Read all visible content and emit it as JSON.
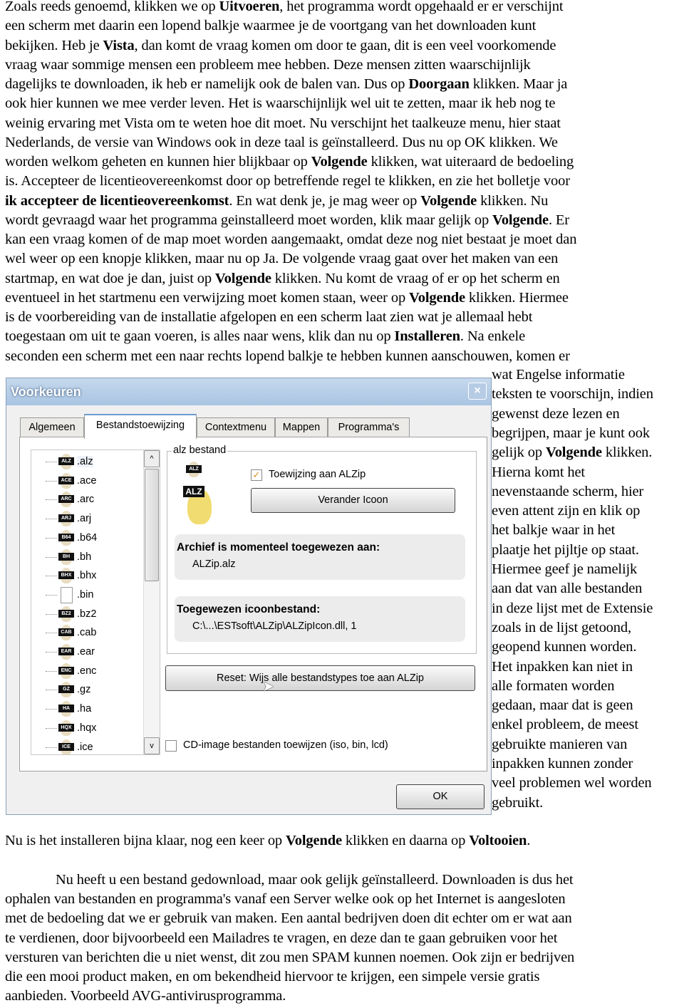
{
  "intro_lines": [
    [
      {
        "t": "Zoals reeds genoemd, klikken we op "
      },
      {
        "t": "Uitvoeren",
        "b": true
      },
      {
        "t": ", het programma wordt opgehaald er er verschijnt"
      }
    ],
    [
      {
        "t": "een scherm met daarin een lopend balkje waarmee je de voortgang van het downloaden kunt"
      }
    ],
    [
      {
        "t": "bekijken. Heb je "
      },
      {
        "t": "Vista",
        "b": true
      },
      {
        "t": ", dan komt de vraag komen om door te gaan, dit is een veel voorkomende"
      }
    ],
    [
      {
        "t": "vraag waar sommige mensen een probleem mee hebben. Deze mensen zitten waarschijnlijk"
      }
    ],
    [
      {
        "t": "dagelijks te downloaden, ik heb er namelijk ook de balen van. Dus op "
      },
      {
        "t": "Doorgaan",
        "b": true
      },
      {
        "t": " klikken. Maar ja"
      }
    ],
    [
      {
        "t": "ook hier kunnen we mee verder leven. Het is waarschijnlijk wel uit te zetten, maar ik heb nog te"
      }
    ],
    [
      {
        "t": "weinig ervaring met Vista om te weten hoe dit moet. Nu verschijnt het taalkeuze menu, hier staat"
      }
    ],
    [
      {
        "t": "Nederlands, de versie van Windows ook in deze taal is geïnstalleerd. Dus nu op OK klikken. We"
      }
    ],
    [
      {
        "t": "worden welkom geheten en kunnen hier blijkbaar op "
      },
      {
        "t": "Volgende",
        "b": true
      },
      {
        "t": " klikken, wat uiteraard de bedoeling"
      }
    ],
    [
      {
        "t": "is. Accepteer de licentieovereenkomst door op betreffende regel te klikken, en zie het bolletje voor"
      }
    ],
    [
      {
        "t": "ik accepteer de licentieovereenkomst",
        "b": true
      },
      {
        "t": ". En wat denk je, je mag weer op "
      },
      {
        "t": "Volgende",
        "b": true
      },
      {
        "t": " klikken. Nu"
      }
    ],
    [
      {
        "t": "wordt gevraagd waar het programma geinstalleerd moet worden, klik maar gelijk op "
      },
      {
        "t": "Volgende",
        "b": true
      },
      {
        "t": ". Er"
      }
    ],
    [
      {
        "t": "kan een vraag komen of de map moet worden aangemaakt, omdat deze nog niet bestaat je moet dan"
      }
    ],
    [
      {
        "t": "wel weer op een knopje klikken, maar nu op Ja. De volgende vraag gaat over het maken van een"
      }
    ],
    [
      {
        "t": "startmap, en wat doe je dan, juist op "
      },
      {
        "t": "Volgende",
        "b": true
      },
      {
        "t": " klikken. Nu komt de vraag of er op het scherm en"
      }
    ],
    [
      {
        "t": "eventueel in het startmenu een verwijzing moet komen staan, weer op "
      },
      {
        "t": "Volgende",
        "b": true
      },
      {
        "t": " klikken. Hiermee"
      }
    ],
    [
      {
        "t": "is de voorbereiding van de installatie afgelopen en een scherm laat zien wat je allemaal hebt"
      }
    ],
    [
      {
        "t": "toegestaan om uit te gaan voeren, is alles naar wens, klik dan nu op "
      },
      {
        "t": "Installeren",
        "b": true
      },
      {
        "t": ". Na enkele"
      }
    ],
    [
      {
        "t": "seconden een scherm met een naar rechts lopend balkje te hebben kunnen aanschouwen, komen er"
      }
    ]
  ],
  "side_lines": [
    [
      {
        "t": "wat Engelse informatie"
      }
    ],
    [
      {
        "t": "teksten te voorschijn, indien"
      }
    ],
    [
      {
        "t": "gewenst deze lezen en"
      }
    ],
    [
      {
        "t": "begrijpen, maar je kunt ook"
      }
    ],
    [
      {
        "t": "gelijk op "
      },
      {
        "t": "Volgende",
        "b": true
      },
      {
        "t": " klikken."
      }
    ],
    [
      {
        "t": "Hierna komt het"
      }
    ],
    [
      {
        "t": "nevenstaande scherm, hier"
      }
    ],
    [
      {
        "t": "even attent zijn en klik op"
      }
    ],
    [
      {
        "t": "het balkje waar in het"
      }
    ],
    [
      {
        "t": "plaatje het pijltje op staat."
      }
    ],
    [
      {
        "t": "Hiermee geef je namelijk"
      }
    ],
    [
      {
        "t": "aan dat van alle bestanden"
      }
    ],
    [
      {
        "t": "in deze lijst met de Extensie"
      }
    ],
    [
      {
        "t": "zoals in de lijst getoond,"
      }
    ],
    [
      {
        "t": "geopend kunnen worden."
      }
    ],
    [
      {
        "t": "Het inpakken kan niet in"
      }
    ],
    [
      {
        "t": "alle formaten worden"
      }
    ],
    [
      {
        "t": "gedaan, maar dat is geen"
      }
    ],
    [
      {
        "t": "enkel probleem, de meest"
      }
    ],
    [
      {
        "t": "gebruikte manieren van"
      }
    ],
    [
      {
        "t": "inpakken kunnen zonder"
      }
    ],
    [
      {
        "t": "veel problemen wel worden"
      }
    ],
    [
      {
        "t": "gebruikt."
      }
    ]
  ],
  "after_lines": [
    [
      {
        "t": "Nu is het installeren bijna klaar, nog een keer op "
      },
      {
        "t": "Volgende",
        "b": true
      },
      {
        "t": " klikken en daarna op "
      },
      {
        "t": "Voltooien",
        "b": true
      },
      {
        "t": "."
      }
    ]
  ],
  "final_lines": [
    [
      {
        "t": "Nu heeft u een bestand gedownload, maar ook gelijk geïnstalleerd. Downloaden is dus het"
      }
    ],
    [
      {
        "t": "ophalen van bestanden en programma's vanaf een Server welke ook op het Internet is aangesloten"
      }
    ],
    [
      {
        "t": "met de bedoeling dat we er gebruik van maken. Een aantal bedrijven doen dit echter om er wat aan"
      }
    ],
    [
      {
        "t": "te verdienen, door bijvoorbeeld een Mailadres te vragen, en deze dan te gaan gebruiken voor het"
      }
    ],
    [
      {
        "t": "versturen van berichten die u niet wenst, dit zou men SPAM kunnen noemen. Ook zijn er bedrijven"
      }
    ],
    [
      {
        "t": "die een mooi product maken, en om bekendheid hiervoor te krijgen, een simpele versie gratis"
      }
    ],
    [
      {
        "t": "aanbieden. Voorbeeld AVG-antivirusprogramma."
      }
    ]
  ],
  "dialog": {
    "title": "Voorkeuren",
    "close": "×",
    "tabs": [
      "Algemeen",
      "Bestandstoewijzing",
      "Contextmenu",
      "Mappen",
      "Programma's"
    ],
    "active_tab": "Bestandstoewijzing",
    "extensions": [
      {
        "ext": ".alz",
        "badge": "ALZ"
      },
      {
        "ext": ".ace",
        "badge": "ACE"
      },
      {
        "ext": ".arc",
        "badge": "ARC"
      },
      {
        "ext": ".arj",
        "badge": "ARJ"
      },
      {
        "ext": ".b64",
        "badge": "B64"
      },
      {
        "ext": ".bh",
        "badge": "BH"
      },
      {
        "ext": ".bhx",
        "badge": "BHX"
      },
      {
        "ext": ".bin",
        "badge": ""
      },
      {
        "ext": ".bz2",
        "badge": "BZ2"
      },
      {
        "ext": ".cab",
        "badge": "CAB"
      },
      {
        "ext": ".ear",
        "badge": "EAR"
      },
      {
        "ext": ".enc",
        "badge": "ENC"
      },
      {
        "ext": ".gz",
        "badge": "GZ"
      },
      {
        "ext": ".ha",
        "badge": "HA"
      },
      {
        "ext": ".hqx",
        "badge": "HQX"
      },
      {
        "ext": ".ice",
        "badge": "ICE"
      }
    ],
    "group_label": "alz bestand",
    "icon_small": "ALZ",
    "icon_large": "ALZ",
    "assign_checkbox": {
      "label": "Toewijzing aan ALZip",
      "checked": true
    },
    "change_icon_button": "Verander Icoon",
    "assigned_heading": "Archief is momenteel toegewezen aan:",
    "assigned_value": "ALZip.alz",
    "iconfile_heading": "Toegewezen icoonbestand:",
    "iconfile_value": "C:\\...\\ESTsoft\\ALZip\\ALZipIcon.dll, 1",
    "reset_button": "Reset: Wijs alle bestandstypes toe aan ALZip",
    "cd_checkbox": {
      "label": "CD-image bestanden toewijzen (iso, bin, lcd)",
      "checked": false
    },
    "ok_button": "OK",
    "scroll_up": "^",
    "scroll_down": "v"
  }
}
